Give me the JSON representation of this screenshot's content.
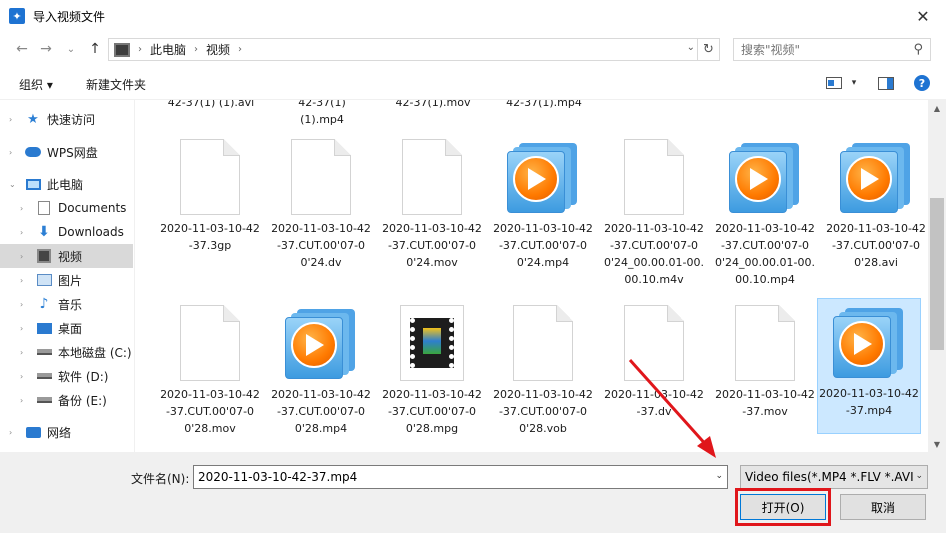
{
  "window": {
    "title": "导入视频文件",
    "app_icon_glyph": "✦",
    "close_glyph": "✕"
  },
  "nav": {
    "back": "←",
    "forward": "→",
    "recent": "⌄",
    "up": "↑"
  },
  "address": {
    "crumbs": [
      "此电脑",
      "视频"
    ],
    "separator": "›",
    "dropdown": "⌄",
    "refresh": "↻"
  },
  "search": {
    "placeholder": "搜索\"视频\"",
    "icon": "⚲"
  },
  "toolbar": {
    "organize_label": "组织 ▾",
    "new_folder_label": "新建文件夹",
    "view_dropdown": "▾",
    "help": "?"
  },
  "sidebar": {
    "items": [
      {
        "label": "快速访问",
        "icon": "star-icon",
        "arrow": "›"
      },
      {
        "label": "WPS网盘",
        "icon": "cloud-icon",
        "arrow": "›"
      },
      {
        "label": "此电脑",
        "icon": "computer-icon",
        "arrow": "⌄"
      },
      {
        "label": "Documents",
        "icon": "document-icon",
        "arrow": "›"
      },
      {
        "label": "Downloads",
        "icon": "download-icon",
        "arrow": "›"
      },
      {
        "label": "视频",
        "icon": "film-icon",
        "arrow": "›"
      },
      {
        "label": "图片",
        "icon": "picture-icon",
        "arrow": "›"
      },
      {
        "label": "音乐",
        "icon": "music-icon",
        "arrow": "›"
      },
      {
        "label": "桌面",
        "icon": "desktop-icon",
        "arrow": "›"
      },
      {
        "label": "本地磁盘 (C:)",
        "icon": "drive-icon",
        "arrow": "›"
      },
      {
        "label": "软件 (D:)",
        "icon": "drive-icon",
        "arrow": "›"
      },
      {
        "label": "备份 (E:)",
        "icon": "drive-icon",
        "arrow": "›"
      },
      {
        "label": "网络",
        "icon": "network-icon",
        "arrow": "›"
      }
    ],
    "selected_index": 5
  },
  "files": {
    "partial_row": [
      "42-37(1) (1).avi",
      "42-37(1)\n(1).mp4",
      "42-37(1).mov",
      "42-37(1).mp4"
    ],
    "row1": [
      {
        "name": "2020-11-03-10-42-37.3gp",
        "icon": "blank"
      },
      {
        "name": "2020-11-03-10-42-37.CUT.00'07-00'24.dv",
        "icon": "blank"
      },
      {
        "name": "2020-11-03-10-42-37.CUT.00'07-00'24.mov",
        "icon": "blank"
      },
      {
        "name": "2020-11-03-10-42-37.CUT.00'07-00'24.mp4",
        "icon": "wmp"
      },
      {
        "name": "2020-11-03-10-42-37.CUT.00'07-00'24_00.00.01-00.00.10.m4v",
        "icon": "blank"
      },
      {
        "name": "2020-11-03-10-42-37.CUT.00'07-00'24_00.00.01-00.00.10.mp4",
        "icon": "wmp"
      },
      {
        "name": "2020-11-03-10-42-37.CUT.00'07-00'28.avi",
        "icon": "wmp"
      }
    ],
    "row2": [
      {
        "name": "2020-11-03-10-42-37.CUT.00'07-00'28.mov",
        "icon": "blank"
      },
      {
        "name": "2020-11-03-10-42-37.CUT.00'07-00'28.mp4",
        "icon": "wmp"
      },
      {
        "name": "2020-11-03-10-42-37.CUT.00'07-00'28.mpg",
        "icon": "mpg"
      },
      {
        "name": "2020-11-03-10-42-37.CUT.00'07-00'28.vob",
        "icon": "blank"
      },
      {
        "name": "2020-11-03-10-42-37.dv",
        "icon": "blank"
      },
      {
        "name": "2020-11-03-10-42-37.mov",
        "icon": "blank"
      },
      {
        "name": "2020-11-03-10-42-37.mp4",
        "icon": "wmp",
        "selected": true
      }
    ]
  },
  "bottom": {
    "filename_label": "文件名(N):",
    "filename_value": "2020-11-03-10-42-37.mp4",
    "dropdown": "⌄",
    "filter_label": "Video files(*.MP4 *.FLV *.AVI",
    "open_label": "打开(O)",
    "cancel_label": "取消"
  },
  "scroll": {
    "up": "▲",
    "down": "▼"
  },
  "colors": {
    "accent": "#0078d7",
    "selection": "#cce8ff",
    "annotation_red": "#e0161b"
  }
}
